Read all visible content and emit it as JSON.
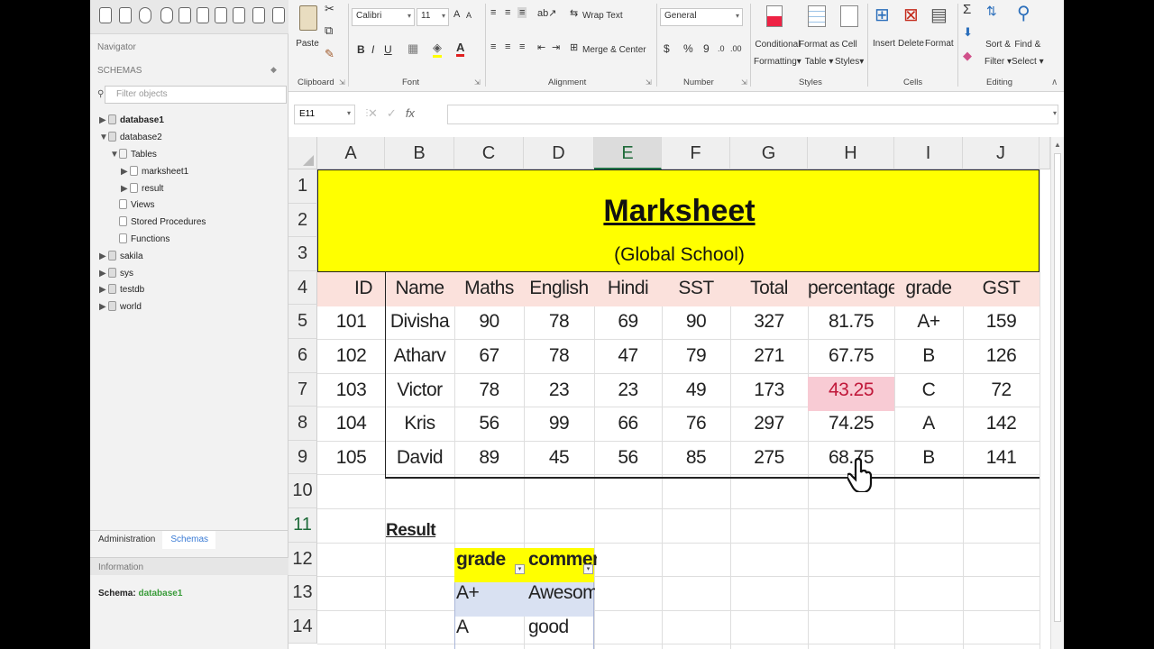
{
  "navigator": {
    "title": "Navigator",
    "schemas_label": "SCHEMAS",
    "filter_placeholder": "Filter objects",
    "tree": {
      "database1": "database1",
      "database2": "database2",
      "tables": "Tables",
      "marksheet1": "marksheet1",
      "result": "result",
      "views": "Views",
      "stored_procedures": "Stored Procedures",
      "functions": "Functions",
      "sakila": "sakila",
      "sys": "sys",
      "testdb": "testdb",
      "world": "world"
    },
    "tabs": [
      "Administration",
      "Schemas"
    ],
    "info_label": "Information",
    "schema_label": "Schema:",
    "schema_value": "database1"
  },
  "ribbon": {
    "clipboard": {
      "paste": "Paste",
      "label": "Clipboard"
    },
    "font": {
      "name": "Calibri",
      "size": "11",
      "label": "Font",
      "bold": "B",
      "italic": "I",
      "underline": "U"
    },
    "alignment": {
      "wrap_text": "Wrap Text",
      "merge_center": "Merge & Center",
      "label": "Alignment"
    },
    "number": {
      "format": "General",
      "currency": "$",
      "percent": "%",
      "comma": "9",
      "label": "Number"
    },
    "styles": {
      "conditional_1": "Conditional",
      "conditional_2": "Formatting",
      "format_table_1": "Format as",
      "format_table_2": "Table",
      "cell_styles_1": "Cell",
      "cell_styles_2": "Styles",
      "label": "Styles"
    },
    "cells": {
      "insert": "Insert",
      "delete": "Delete",
      "format": "Format",
      "label": "Cells"
    },
    "editing": {
      "sort_1": "Sort &",
      "sort_2": "Filter",
      "find_1": "Find &",
      "find_2": "Select",
      "label": "Editing"
    }
  },
  "formula_bar": {
    "name_box": "E11",
    "fx": "fx",
    "formula": ""
  },
  "columns": [
    "A",
    "B",
    "C",
    "D",
    "E",
    "F",
    "G",
    "H",
    "I",
    "J"
  ],
  "selected_column": "E",
  "rows": [
    "1",
    "2",
    "3",
    "4",
    "5",
    "6",
    "7",
    "8",
    "9",
    "10",
    "11",
    "12",
    "13",
    "14"
  ],
  "selected_row": "11",
  "sheet": {
    "title": "Marksheet",
    "subtitle": "(Global School)",
    "headers": [
      "ID",
      "Name",
      "Maths",
      "English",
      "Hindi",
      "SST",
      "Total",
      "percentage",
      "grade",
      "GST"
    ],
    "records": [
      [
        "101",
        "Divisha",
        "90",
        "78",
        "69",
        "90",
        "327",
        "81.75",
        "A+",
        "159"
      ],
      [
        "102",
        "Atharv",
        "67",
        "78",
        "47",
        "79",
        "271",
        "67.75",
        "B",
        "126"
      ],
      [
        "103",
        "Victor",
        "78",
        "23",
        "23",
        "49",
        "173",
        "43.25",
        "C",
        "72"
      ],
      [
        "104",
        "Kris",
        "56",
        "99",
        "66",
        "76",
        "297",
        "74.25",
        "A",
        "142"
      ],
      [
        "105",
        "David",
        "89",
        "45",
        "56",
        "85",
        "275",
        "68.75",
        "B",
        "141"
      ]
    ],
    "highlight_color": "#f8cbd4",
    "highlight_text_color": "#c0183a",
    "result_label": "Result",
    "result_headers": [
      "grade",
      "comment"
    ],
    "result_rows": [
      [
        "A+",
        "Awesome"
      ],
      [
        "A",
        "good"
      ]
    ]
  },
  "colors": {
    "banner": "#ffff00",
    "header_row": "#fbe1dc",
    "excel_green": "#217346",
    "result_row": "#d9e1f2"
  }
}
